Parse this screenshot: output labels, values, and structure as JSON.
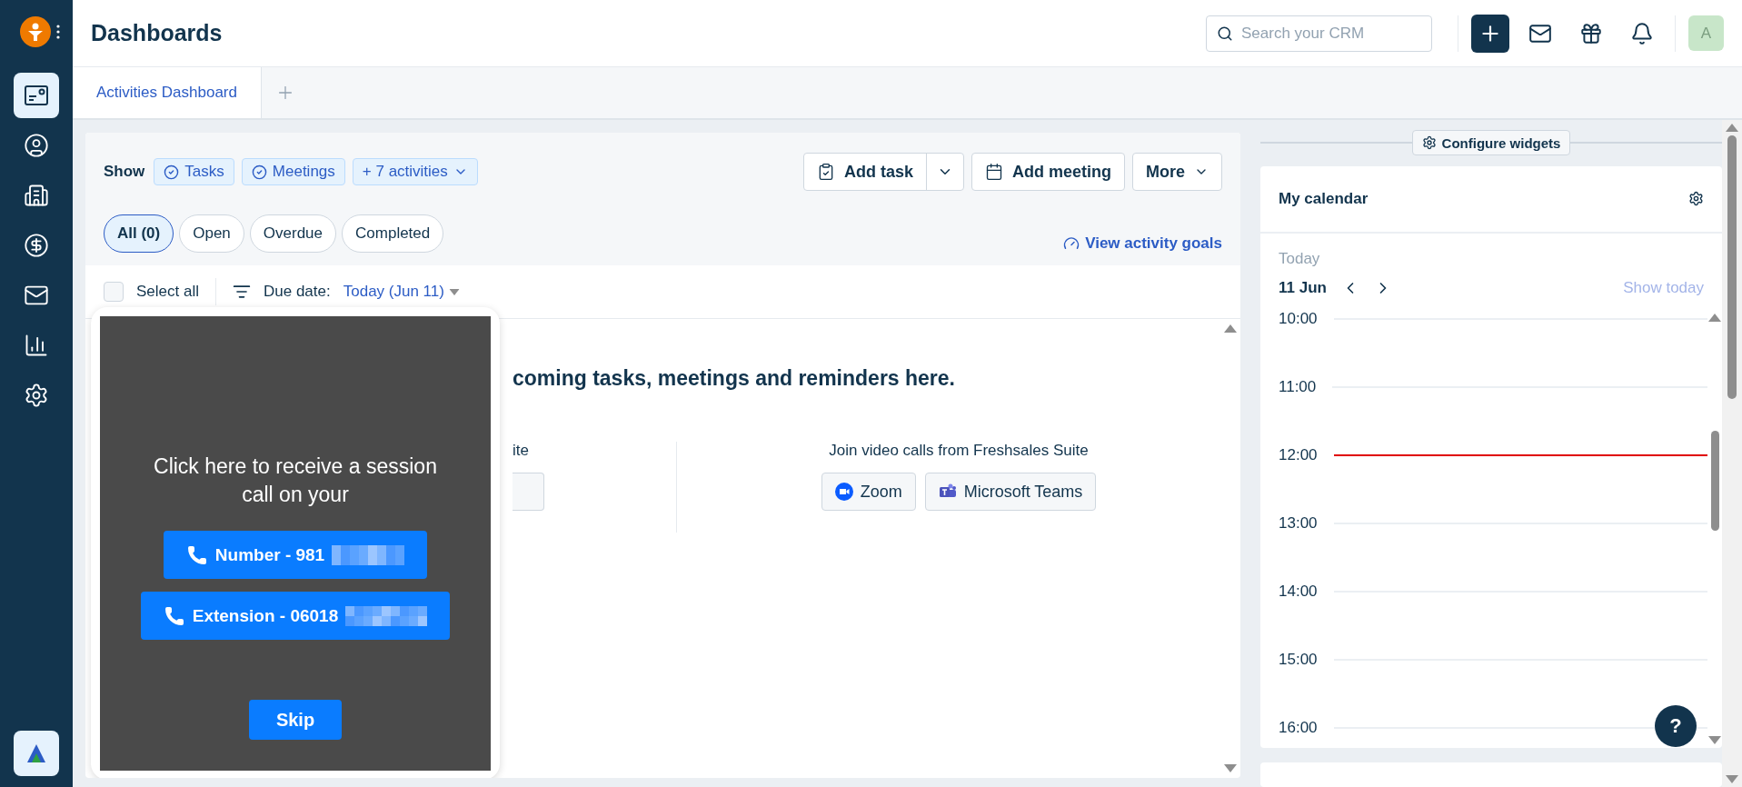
{
  "sidebar": {
    "items": [
      {
        "kind": "dashboard",
        "selected": true
      },
      {
        "kind": "contacts",
        "selected": false
      },
      {
        "kind": "accounts",
        "selected": false
      },
      {
        "kind": "deals",
        "selected": false
      },
      {
        "kind": "email",
        "selected": false
      },
      {
        "kind": "reports",
        "selected": false
      },
      {
        "kind": "settings",
        "selected": false
      }
    ]
  },
  "header": {
    "title": "Dashboards",
    "search": {
      "placeholder": "Search your CRM"
    },
    "avatar": "A"
  },
  "tabs": [
    {
      "label": "Activities Dashboard",
      "selected": true
    }
  ],
  "filters": {
    "show_label": "Show",
    "chips": [
      {
        "label": "Tasks",
        "kind": "check"
      },
      {
        "label": "Meetings",
        "kind": "check"
      },
      {
        "label": "+ 7 activities",
        "kind": "dropdown"
      }
    ]
  },
  "actions": {
    "add_task": "Add task",
    "add_meeting": "Add meeting",
    "more": "More"
  },
  "status_tabs": [
    {
      "label": "All (0)",
      "selected": true
    },
    {
      "label": "Open",
      "selected": false
    },
    {
      "label": "Overdue",
      "selected": false
    },
    {
      "label": "Completed",
      "selected": false
    }
  ],
  "goals_link": "View activity goals",
  "list_toolbar": {
    "select_all": {
      "label": "Select all",
      "checked": false
    },
    "due_date_label": "Due date:",
    "due_date_value": "Today (Jun 11)"
  },
  "empty_state": {
    "message": "coming tasks, meetings and reminders here.",
    "left_column_title": "ite",
    "video_title": "Join video calls from Freshsales Suite",
    "video_buttons": [
      {
        "label": "Zoom",
        "kind": "zoom"
      },
      {
        "label": "Microsoft Teams",
        "kind": "teams"
      }
    ]
  },
  "popup": {
    "message": "Click here to receive a session call on your",
    "call_options": [
      {
        "label": "Number - 981"
      },
      {
        "label": "Extension - 06018"
      }
    ],
    "skip": "Skip"
  },
  "widgets": {
    "configure": "Configure widgets",
    "calendar": {
      "title": "My calendar",
      "today_label": "Today",
      "date": "11 Jun",
      "show_today": "Show today",
      "hours": [
        {
          "label": "10:00",
          "current": false
        },
        {
          "label": "11:00",
          "current": false
        },
        {
          "label": "12:00",
          "current": true
        },
        {
          "label": "13:00",
          "current": false
        },
        {
          "label": "14:00",
          "current": false
        },
        {
          "label": "15:00",
          "current": false
        },
        {
          "label": "16:00",
          "current": false
        }
      ]
    }
  },
  "help": "?"
}
